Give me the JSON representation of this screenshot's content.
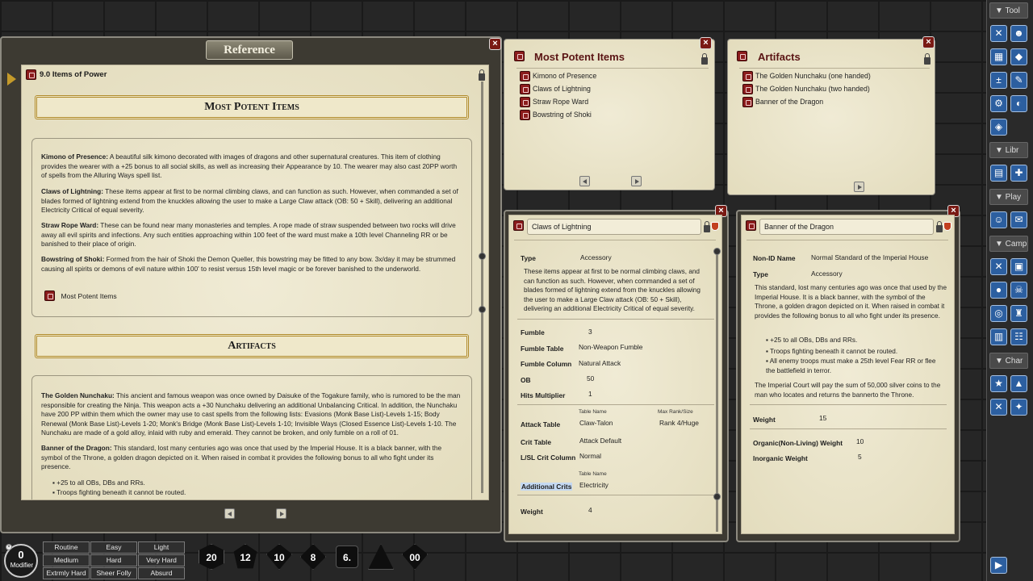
{
  "reference": {
    "title": "Reference",
    "chapter": "9.0 Items of Power",
    "section1_title": "Most Potent Items",
    "kimono_name": "Kimono of Presence:",
    "kimono_text": " A beautiful silk kimono decorated with images of dragons and other supernatural creatures. This item of clothing provides the wearer with a +25 bonus to all social skills, as well as increasing their Appearance by 10. The wearer may also cast 20PP worth of spells from the Alluring Ways spell list.",
    "claws_name": "Claws of Lightning:",
    "claws_text": " These items appear at first to be normal climbing claws, and can function as such. However, when commanded a set of blades formed of lightning extend from the knuckles allowing the user to make a Large Claw attack (OB: 50 + Skill), delivering an additional Electricity Critical of equal severity.",
    "rope_name": "Straw Rope Ward:",
    "rope_text": " These can be found near many monasteries and temples. A rope made of straw suspended between two rocks will drive away all evil spirits and infections. Any such entities approaching within 100 feet of the ward must make a 10th level Channeling RR or be banished to their place of origin.",
    "bow_name": "Bowstring of Shoki:",
    "bow_text": " Formed from the hair of Shoki the Demon Queller, this bowstring may be fitted to any bow. 3x/day it may be strummed causing all spirits or demons of evil nature within 100' to resist versus 15th level magic or be forever banished to the underworld.",
    "link_label": "Most Potent Items",
    "section2_title": "Artifacts",
    "nunchaku_name": "The Golden Nunchaku:",
    "nunchaku_text": " This ancient and famous weapon was once owned by Daisuke of the Togakure family, who is rumored to be the man responsible for creating the Ninja. This weapon acts a +30 Nunchaku delivering an additional Unbalancing Critical. In addition, the Nunchaku have 200 PP within them which the owner may use to cast spells from the following lists: Evasions (Monk Base List)-Levels 1-15; Body Renewal (Monk Base List)-Levels 1-20; Monk's Bridge (Monk Base List)-Levels 1-10; Invisible Ways (Closed Essence List)-Levels 1-10. The Nunchaku are made of a gold alloy, inlaid with ruby and emerald. They cannot be broken, and only fumble on a roll of 01.",
    "banner_name": "Banner of the Dragon:",
    "banner_text": " This standard, lost many centuries ago was once that used by the Imperial House. It is a black banner, with the symbol of the Throne, a golden dragon depicted on it. When raised in combat it provides the following bonus to all who fight under its presence.",
    "bullet1": "+25 to all OBs, DBs and RRs.",
    "bullet2": "Troops fighting beneath it cannot be routed."
  },
  "potent_list": {
    "title": "Most Potent Items",
    "items": [
      "Kimono of Presence",
      "Claws of Lightning",
      "Straw Rope Ward",
      "Bowstring of Shoki"
    ]
  },
  "artifacts_list": {
    "title": "Artifacts",
    "items": [
      "The Golden Nunchaku (one handed)",
      "The Golden Nunchaku (two handed)",
      "Banner of the Dragon"
    ]
  },
  "claws": {
    "name": "Claws of Lightning",
    "type_label": "Type",
    "type": "Accessory",
    "desc": "These items appear at first to be normal climbing claws, and can function as such. However, when commanded a set of blades formed of lightning extend from the knuckles allowing the user to make a Large Claw attack (OB: 50 + Skill), delivering an additional Electricity Critical of equal severity.",
    "fumble_label": "Fumble",
    "fumble": "3",
    "fumble_table_label": "Fumble Table",
    "fumble_table": "Non-Weapon Fumble",
    "fumble_column_label": "Fumble Column",
    "fumble_column": "Natural Attack",
    "ob_label": "OB",
    "ob": "50",
    "hits_label": "Hits Multiplier",
    "hits": "1",
    "table_name_hdr": "Table Name",
    "max_rank_hdr": "Max Rank/Size",
    "attack_table_label": "Attack Table",
    "attack_table": "Claw-Talon",
    "attack_rank": "Rank 4/Huge",
    "crit_table_label": "Crit Table",
    "crit_table": "Attack Default",
    "lsl_label": "L/SL Crit Column",
    "lsl": "Normal",
    "table_name_hdr2": "Table Name",
    "add_crits_label": "Additional Crits",
    "add_crits": "Electricity",
    "weight_label": "Weight",
    "weight": "4"
  },
  "banner": {
    "name": "Banner of the Dragon",
    "nonid_label": "Non-ID Name",
    "nonid": "Normal Standard of the Imperial House",
    "type_label": "Type",
    "type": "Accessory",
    "desc": "This standard, lost many centuries ago was once that used by the Imperial House. It is a black banner, with the symbol of the Throne, a golden dragon depicted on it. When raised in combat it provides the following bonus to all who fight under its presence.",
    "b1": "+25 to all OBs, DBs and RRs.",
    "b2": "Troops fighting beneath it cannot be routed.",
    "b3": "All enemy troops must make a 25th level Fear RR or flee the battlefield in terror.",
    "reward": "The Imperial Court will pay the sum of 50,000 silver coins to the man who locates and returns the bannerto the Throne.",
    "weight_label": "Weight",
    "weight": "15",
    "org_label": "Organic(Non-Living) Weight",
    "org": "10",
    "inorg_label": "Inorganic Weight",
    "inorg": "5"
  },
  "sidebar": {
    "tool": "▼ Tool",
    "libr": "▼ Libr",
    "play": "▼ Play",
    "camp": "▼ Camp",
    "char": "▼ Char"
  },
  "modifier": {
    "value": "0",
    "label": "Modifier",
    "cells": [
      "Routine",
      "Easy",
      "Light",
      "Medium",
      "Hard",
      "Very Hard",
      "Extrmly Hard",
      "Sheer Folly",
      "Absurd"
    ]
  },
  "dice": [
    "20",
    "12",
    "10",
    "8",
    "6.",
    "4",
    "00"
  ]
}
